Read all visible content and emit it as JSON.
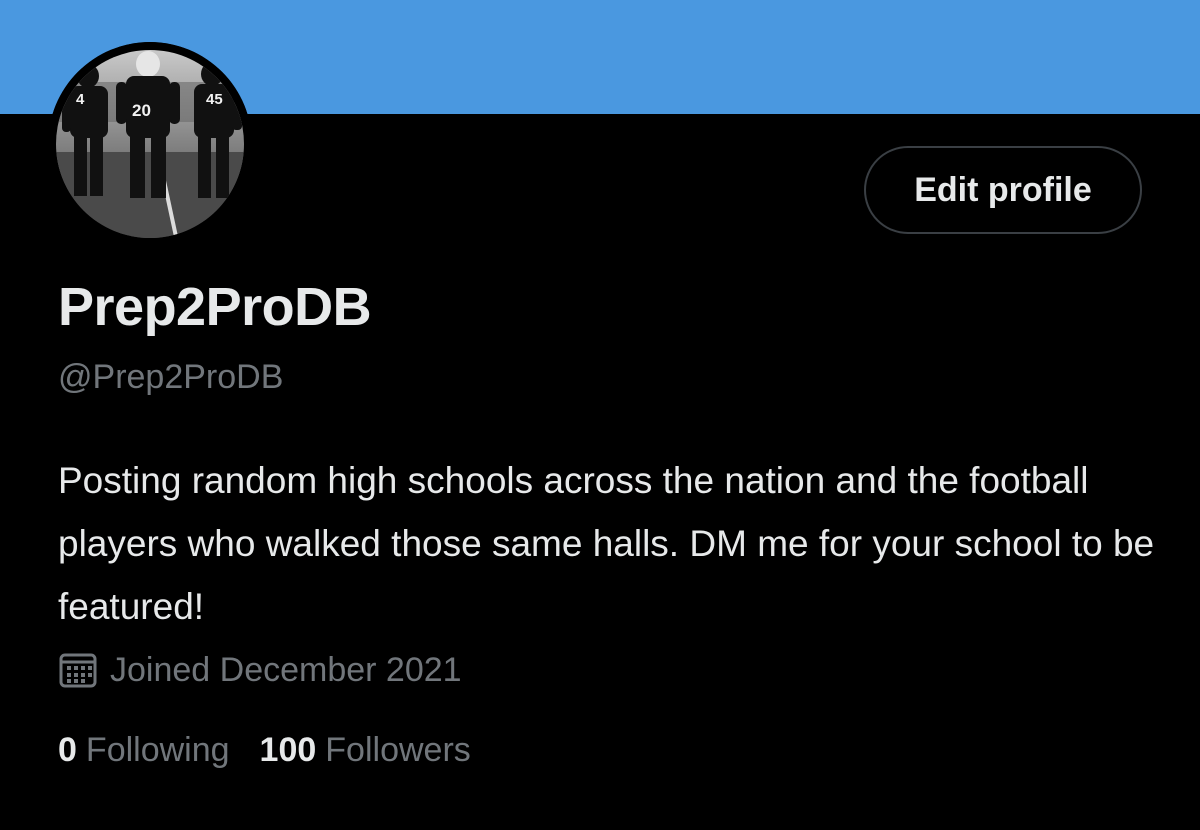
{
  "profile": {
    "display_name": "Prep2ProDB",
    "handle": "@Prep2ProDB",
    "bio": "Posting random high schools across the nation and the football players who walked those same halls. DM me for your school to be featured!",
    "joined": "Joined December 2021",
    "edit_label": "Edit profile",
    "avatar_jersey_numbers": [
      "4",
      "20",
      "45"
    ]
  },
  "stats": {
    "following_count": "0",
    "following_label": "Following",
    "followers_count": "100",
    "followers_label": "Followers"
  },
  "icons": {
    "joined": "calendar-icon"
  },
  "colors": {
    "banner": "#4a98e0",
    "background": "#000000",
    "primary_text": "#e7e9ea",
    "secondary_text": "#71767b",
    "button_border": "#3a3f44"
  }
}
